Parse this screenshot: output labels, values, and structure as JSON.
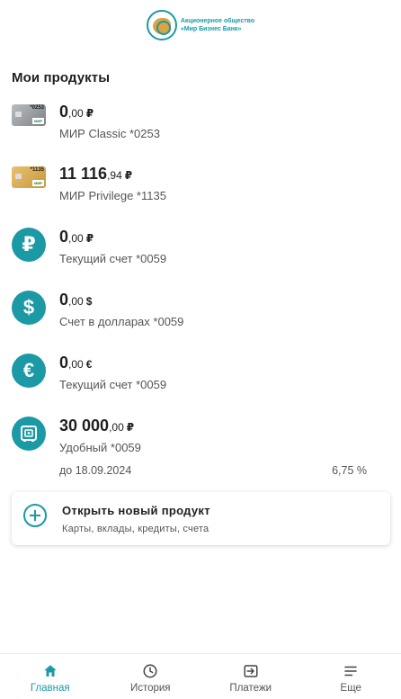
{
  "header": {
    "logo_line1": "Акционерное общество",
    "logo_line2": "«Мир Бизнес Банк»"
  },
  "section_title": "Мои продукты",
  "products": [
    {
      "icon": "card-classic",
      "card_num": "*0253",
      "amount_int": "0",
      "amount_frac": ",00",
      "currency": "₽",
      "title": "МИР Classic *0253"
    },
    {
      "icon": "card-privilege",
      "card_num": "*1135",
      "amount_int": "11 116",
      "amount_frac": ",94",
      "currency": "₽",
      "title": "МИР Privilege *1135"
    },
    {
      "icon": "ruble-icon",
      "glyph": "₽",
      "amount_int": "0",
      "amount_frac": ",00",
      "currency": "₽",
      "title": "Текущий счет *0059"
    },
    {
      "icon": "dollar-icon",
      "glyph": "$",
      "amount_int": "0",
      "amount_frac": ",00",
      "currency": "$",
      "title": "Счет в долларах *0059"
    },
    {
      "icon": "euro-icon",
      "glyph": "€",
      "amount_int": "0",
      "amount_frac": ",00",
      "currency": "€",
      "title": "Текущий счет *0059"
    },
    {
      "icon": "safe-icon",
      "amount_int": "30 000",
      "amount_frac": ",00",
      "currency": "₽",
      "title": "Удобный *0059",
      "until": "до 18.09.2024",
      "rate": "6,75 %"
    }
  ],
  "open_product": {
    "title": "Открыть новый продукт",
    "subtitle": "Карты, вклады, кредиты, счета"
  },
  "nav": [
    {
      "label": "Главная",
      "icon": "home-icon",
      "active": true
    },
    {
      "label": "История",
      "icon": "clock-icon",
      "active": false
    },
    {
      "label": "Платежи",
      "icon": "payment-icon",
      "active": false
    },
    {
      "label": "Еще",
      "icon": "menu-icon",
      "active": false
    }
  ],
  "colors": {
    "accent": "#1b9aa6"
  },
  "card_label": "МИР"
}
